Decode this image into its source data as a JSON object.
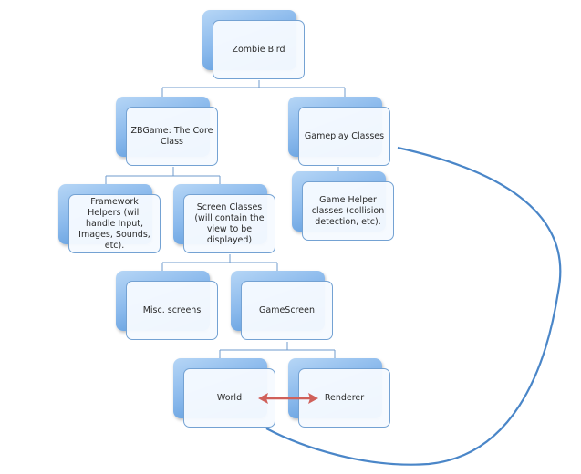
{
  "diagram": {
    "type": "hierarchy",
    "nodes": [
      {
        "id": "zombie-bird",
        "label": "Zombie Bird",
        "parent": null
      },
      {
        "id": "zbgame",
        "label": "ZBGame: The Core Class",
        "parent": "zombie-bird"
      },
      {
        "id": "gameplay-classes",
        "label": "Gameplay Classes",
        "parent": "zombie-bird"
      },
      {
        "id": "framework-helpers",
        "label": "Framework Helpers (will handle Input, Images, Sounds, etc).",
        "parent": "zbgame"
      },
      {
        "id": "screen-classes",
        "label": "Screen Classes (will contain the view to be displayed)",
        "parent": "zbgame"
      },
      {
        "id": "game-helper",
        "label": "Game Helper classes (collision detection, etc).",
        "parent": "gameplay-classes"
      },
      {
        "id": "misc-screens",
        "label": "Misc. screens",
        "parent": "screen-classes"
      },
      {
        "id": "gamescreen",
        "label": "GameScreen",
        "parent": "screen-classes"
      },
      {
        "id": "world",
        "label": "World",
        "parent": "gamescreen"
      },
      {
        "id": "renderer",
        "label": "Renderer",
        "parent": "gamescreen"
      }
    ],
    "relations": [
      {
        "from": "world",
        "to": "renderer",
        "type": "bidirectional-arrow",
        "color": "#d0605a"
      },
      {
        "from": "gameplay-classes",
        "to": "world",
        "type": "curved-connector",
        "color": "#4a86c8"
      }
    ],
    "colors": {
      "connector": "#6f9bcc",
      "box_border": "#74a2d3",
      "box_fill": "#f6faff",
      "shadow_box_top": "#b6d6f6",
      "shadow_box_bottom": "#4b8fd6",
      "text": "#2a2a2a"
    }
  }
}
